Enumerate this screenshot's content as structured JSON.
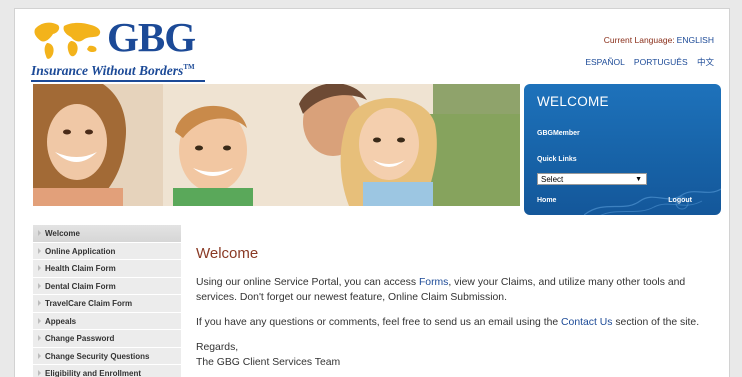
{
  "brand": {
    "name": "GBG",
    "tagline": "Insurance Without Borders",
    "trademark": "TM",
    "primary_color": "#1c4a97",
    "accent_color": "#f3b31b"
  },
  "language": {
    "current_label": "Current Language:",
    "current_value": "ENGLISH",
    "options": [
      "ESPAÑOL",
      "PORTUGUÊS",
      "中文"
    ]
  },
  "welcome_box": {
    "title": "WELCOME",
    "username": "GBGMember",
    "quick_links_label": "Quick Links",
    "select_value": "Select",
    "home_label": "Home",
    "logout_label": "Logout",
    "background_color": "#1763a8"
  },
  "sidebar": {
    "items": [
      {
        "label": "Welcome"
      },
      {
        "label": "Online Application"
      },
      {
        "label": "Health Claim Form"
      },
      {
        "label": "Dental Claim Form"
      },
      {
        "label": "TravelCare Claim Form"
      },
      {
        "label": "Appeals"
      },
      {
        "label": "Change Password"
      },
      {
        "label": "Change Security Questions"
      },
      {
        "label": "Eligibility and Enrollment"
      }
    ]
  },
  "content": {
    "heading": "Welcome",
    "p1_before": "Using our online Service Portal, you can access ",
    "p1_link": "Forms",
    "p1_after": ", view your Claims, and utilize many other tools and services. Don't forget our newest feature, Online Claim Submission.",
    "p2_before": "If you have any questions or comments, feel free to send us an email using the ",
    "p2_link": "Contact Us",
    "p2_after": " section of the site.",
    "regards": "Regards,",
    "signature": "The GBG Client Services Team"
  }
}
